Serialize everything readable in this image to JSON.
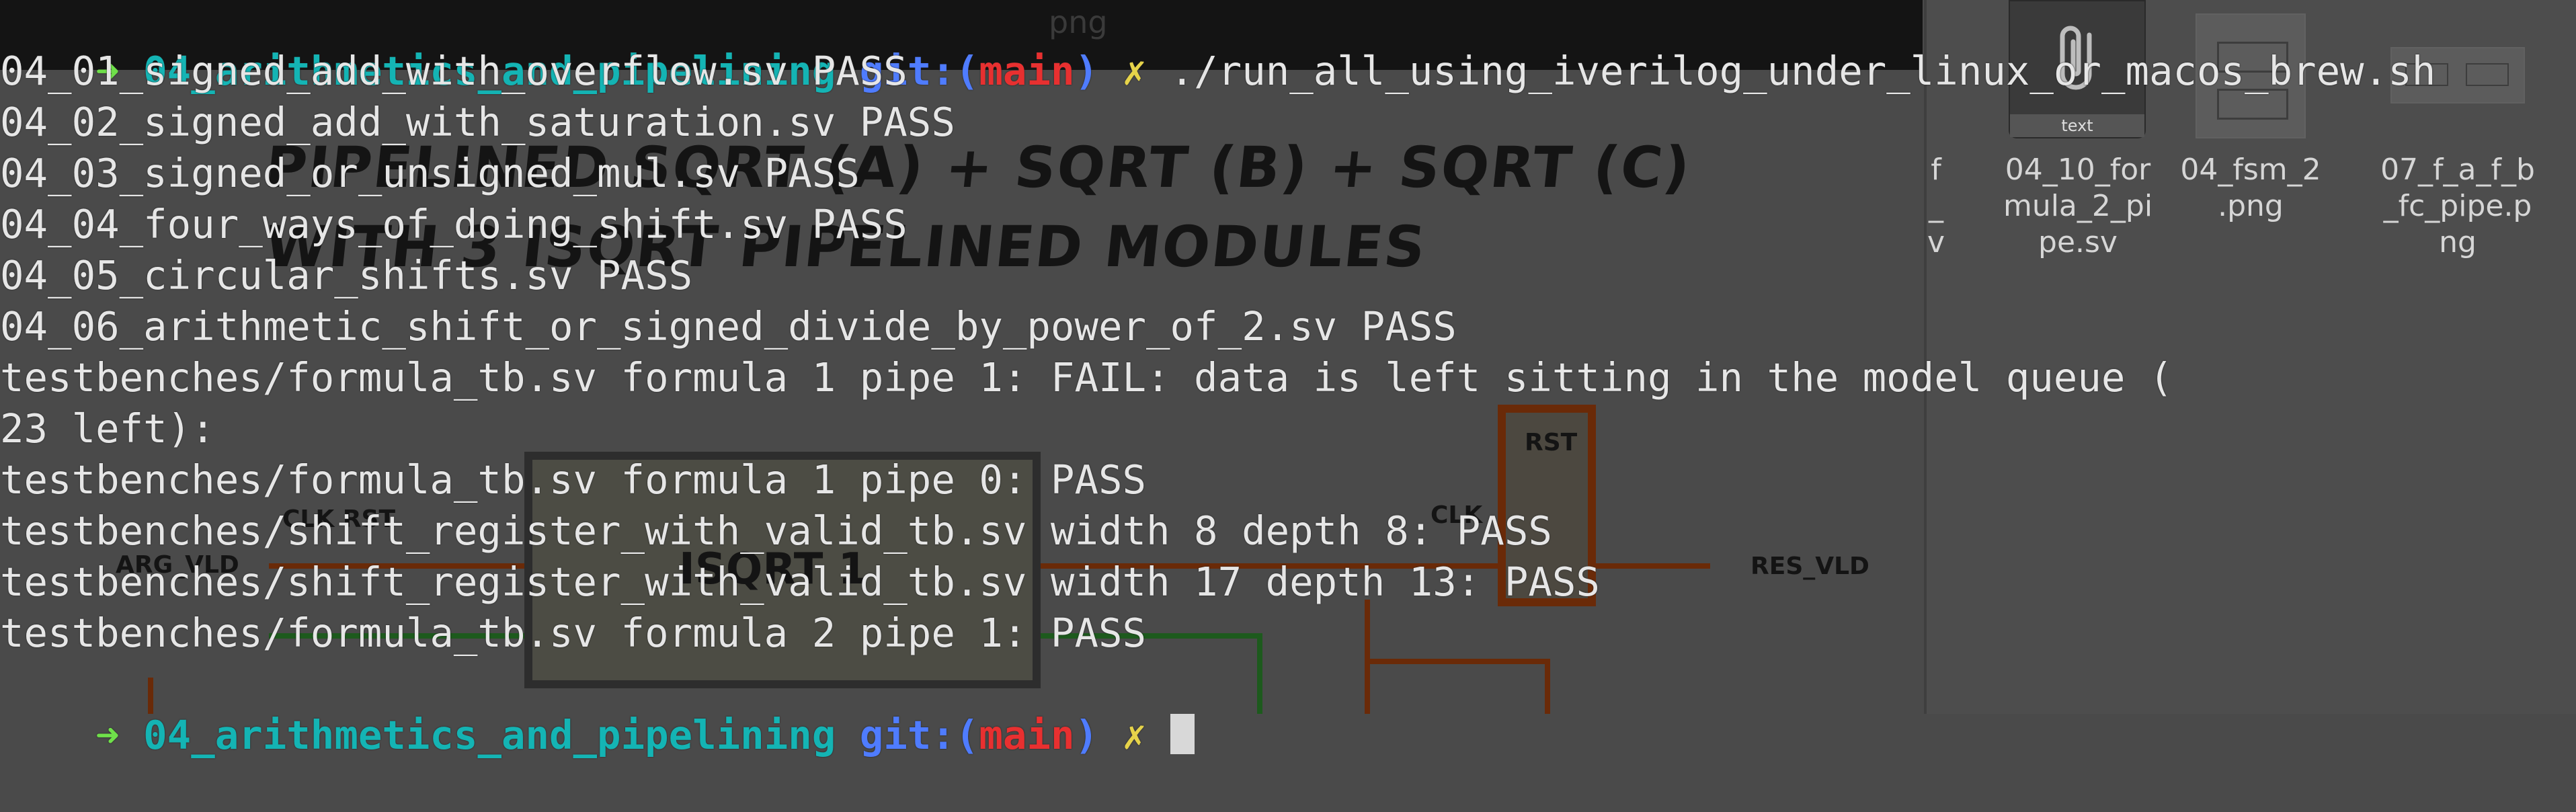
{
  "terminal": {
    "prompt": {
      "arrow": "➜",
      "dir": "04_arithmetics_and_pipelining",
      "git_label": "git:(",
      "branch": "main",
      "git_close": ")",
      "dirty": "✗"
    },
    "command": "./run_all_using_iverilog_under_linux_or_macos_brew.sh",
    "output": [
      "04_01_signed_add_with_overflow.sv PASS",
      "04_02_signed_add_with_saturation.sv PASS",
      "04_03_signed_or_unsigned_mul.sv PASS",
      "04_04_four_ways_of_doing_shift.sv PASS",
      "04_05_circular_shifts.sv PASS",
      "04_06_arithmetic_shift_or_signed_divide_by_power_of_2.sv PASS",
      "testbenches/formula_tb.sv formula 1 pipe 1: FAIL: data is left sitting in the model queue (",
      "23 left):",
      "testbenches/formula_tb.sv formula 1 pipe 0: PASS",
      "testbenches/shift_register_with_valid_tb.sv width 8 depth 8: PASS",
      "testbenches/shift_register_with_valid_tb.sv width 17 depth 13: PASS",
      "testbenches/formula_tb.sv formula 2 pipe 1: PASS"
    ]
  },
  "background_diagram": {
    "title_line1": "PIPELINED SQRT (A) + SQRT (B) + SQRT (C)",
    "title_line2": "WITH 3 ISQRT PIPELINED MODULES",
    "labels": {
      "clk_rst": "CLK RST",
      "arg_vld": "ARG_VLD",
      "isqrt": "ISQRT 1",
      "rst": "RST",
      "clk": "CLK",
      "res_vld": "RES_VLD"
    }
  },
  "file_manager": {
    "items": [
      {
        "name": "f\n_\nv"
      },
      {
        "name": "04_10_for\nmula_2_pi\npe.sv",
        "icon": "text-file-icon",
        "badge": "text"
      },
      {
        "name": "04_fsm_2\n.png",
        "icon": "image-thumbnail"
      },
      {
        "name": "07_f_a_f_b\n_fc_pipe.p\nng",
        "icon": "image-thumbnail"
      }
    ],
    "hidden_tab_fragment": "png"
  },
  "colors": {
    "prompt_arrow": "#6fe04a",
    "prompt_dir": "#14b4b4",
    "git": "#4f7cff",
    "branch": "#e83030",
    "dirty_mark": "#e6d34a",
    "wire": "#6a2a08"
  }
}
